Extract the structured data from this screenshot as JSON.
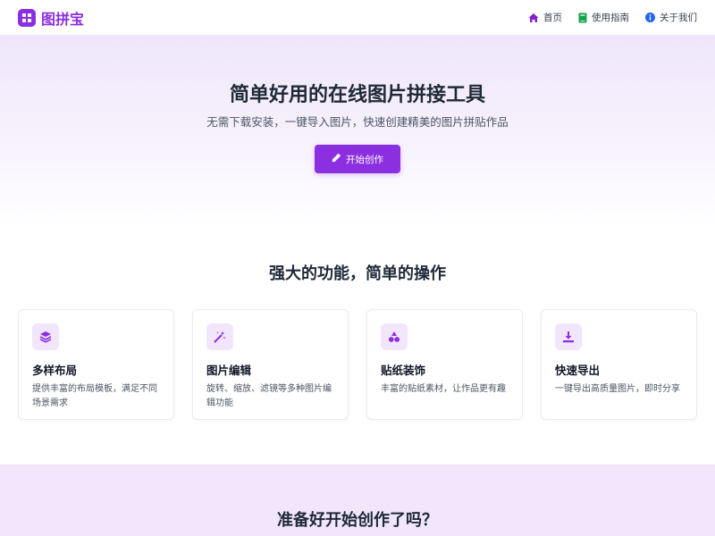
{
  "brand": {
    "name": "图拼宝",
    "logo_icon": "grid-icon",
    "accent_color": "#8b2fe0"
  },
  "nav": {
    "items": [
      {
        "label": "首页",
        "icon": "home-icon",
        "icon_color": "#7e22ce"
      },
      {
        "label": "使用指南",
        "icon": "book-icon",
        "icon_color": "#16a34a"
      },
      {
        "label": "关于我们",
        "icon": "info-icon",
        "icon_color": "#2563eb"
      }
    ]
  },
  "hero": {
    "title": "简单好用的在线图片拼接工具",
    "subtitle": "无需下载安装，一键导入图片，快速创建精美的图片拼贴作品",
    "cta_label": "开始创作",
    "cta_icon": "pencil-icon"
  },
  "features": {
    "title": "强大的功能，简单的操作",
    "cards": [
      {
        "title": "多样布局",
        "desc": "提供丰富的布局模板，满足不同场景需求",
        "icon": "layers-icon"
      },
      {
        "title": "图片编辑",
        "desc": "旋转、缩放、滤镜等多种图片编辑功能",
        "icon": "magic-wand-icon"
      },
      {
        "title": "贴纸装饰",
        "desc": "丰富的贴纸素材，让作品更有趣",
        "icon": "shapes-icon"
      },
      {
        "title": "快速导出",
        "desc": "一键导出高质量图片，即时分享",
        "icon": "download-icon"
      }
    ]
  },
  "bottom_cta": {
    "title": "准备好开始创作了吗？"
  }
}
